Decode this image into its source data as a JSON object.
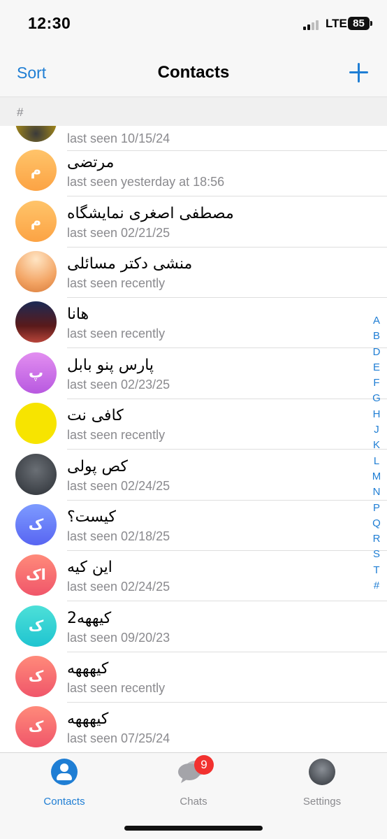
{
  "status_bar": {
    "time": "12:30",
    "network": "LTE",
    "battery": "85"
  },
  "nav": {
    "sort_label": "Sort",
    "title": "Contacts",
    "add_icon": "plus-icon"
  },
  "section": {
    "label": "#"
  },
  "contacts": [
    {
      "name": "",
      "status": "last seen 10/15/24",
      "avatar_letter": ""
    },
    {
      "name": "مرتضی",
      "status": "last seen yesterday at 18:56",
      "avatar_letter": "م"
    },
    {
      "name": "مصطفی اصغری نمایشگاه",
      "status": "last seen 02/21/25",
      "avatar_letter": "م"
    },
    {
      "name": "منشی دکتر مسائلی",
      "status": "last seen recently",
      "avatar_letter": ""
    },
    {
      "name": "هانا",
      "status": "last seen recently",
      "avatar_letter": ""
    },
    {
      "name": "پارس پنو بابل",
      "status": "last seen 02/23/25",
      "avatar_letter": "پ"
    },
    {
      "name": "کافی نت",
      "status": "last seen recently",
      "avatar_letter": ""
    },
    {
      "name": "کص پولی",
      "status": "last seen 02/24/25",
      "avatar_letter": ""
    },
    {
      "name": "کیست؟",
      "status": "last seen 02/18/25",
      "avatar_letter": "ک"
    },
    {
      "name": "این کیه",
      "status": "last seen 02/24/25",
      "avatar_letter": "اک"
    },
    {
      "name": "کیههه2",
      "status": "last seen 09/20/23",
      "avatar_letter": "ک"
    },
    {
      "name": "کیهههه",
      "status": "last seen recently",
      "avatar_letter": "ک"
    },
    {
      "name": "کیهههه",
      "status": "last seen 07/25/24",
      "avatar_letter": "ک"
    }
  ],
  "index_letters": [
    "A",
    "B",
    "D",
    "E",
    "F",
    "G",
    "H",
    "J",
    "K",
    "L",
    "M",
    "N",
    "P",
    "Q",
    "R",
    "S",
    "T",
    "#"
  ],
  "tabs": [
    {
      "label": "Contacts",
      "icon": "person-circle-icon",
      "active": true
    },
    {
      "label": "Chats",
      "icon": "chat-bubbles-icon",
      "badge": "9"
    },
    {
      "label": "Settings",
      "icon": "profile-avatar-icon"
    }
  ],
  "colors": {
    "accent": "#1f7ed4",
    "badge": "#f2312f",
    "secondary_text": "#8a8a8e"
  }
}
